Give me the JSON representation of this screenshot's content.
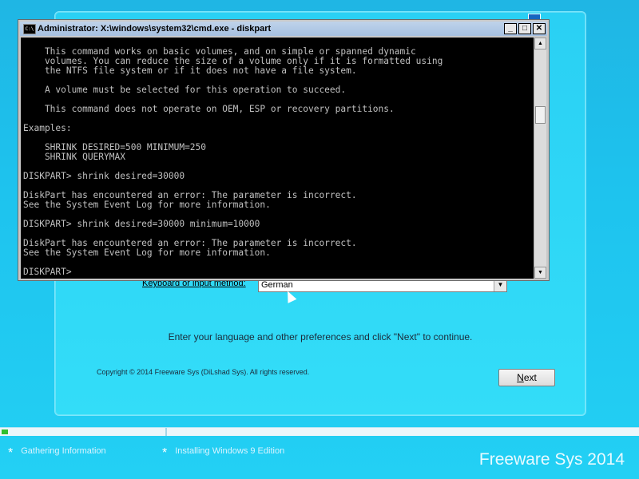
{
  "setup": {
    "keyboard_label": "Keyboard or input method:",
    "keyboard_value": "German",
    "instructions": "Enter your language and other preferences and click \"Next\" to continue.",
    "copyright": "Copyright © 2014 Freeware Sys (DiLshad Sys). All rights reserved.",
    "next_button_hotkey": "N",
    "next_button_rest": "ext"
  },
  "cmd": {
    "title": "Administrator: X:\\windows\\system32\\cmd.exe - diskpart",
    "icon_text": "C:\\",
    "lines": [
      "",
      "    This command works on basic volumes, and on simple or spanned dynamic",
      "    volumes. You can reduce the size of a volume only if it is formatted using",
      "    the NTFS file system or if it does not have a file system.",
      "",
      "    A volume must be selected for this operation to succeed.",
      "",
      "    This command does not operate on OEM, ESP or recovery partitions.",
      "",
      "Examples:",
      "",
      "    SHRINK DESIRED=500 MINIMUM=250",
      "    SHRINK QUERYMAX",
      "",
      "DISKPART> shrink desired=30000",
      "",
      "DiskPart has encountered an error: The parameter is incorrect.",
      "See the System Event Log for more information.",
      "",
      "DISKPART> shrink desired=30000 minimum=10000",
      "",
      "DiskPart has encountered an error: The parameter is incorrect.",
      "See the System Event Log for more information.",
      "",
      "DISKPART>"
    ]
  },
  "taskbar": {
    "steps": [
      {
        "label": "Gathering Information"
      },
      {
        "label": "Installing Windows 9 Edition"
      }
    ],
    "brand": "Freeware Sys 2014"
  },
  "colors": {
    "background": "#1ec3ee",
    "progress_fill": "#2fbf2f",
    "console_bg": "#000000",
    "console_text": "#c0c0c0"
  },
  "icons": [
    "cmd-icon",
    "minimize-icon",
    "maximize-icon",
    "close-icon",
    "scroll-up-icon",
    "scroll-down-icon",
    "dropdown-arrow-icon",
    "mouse-pointer-icon",
    "star-icon"
  ]
}
